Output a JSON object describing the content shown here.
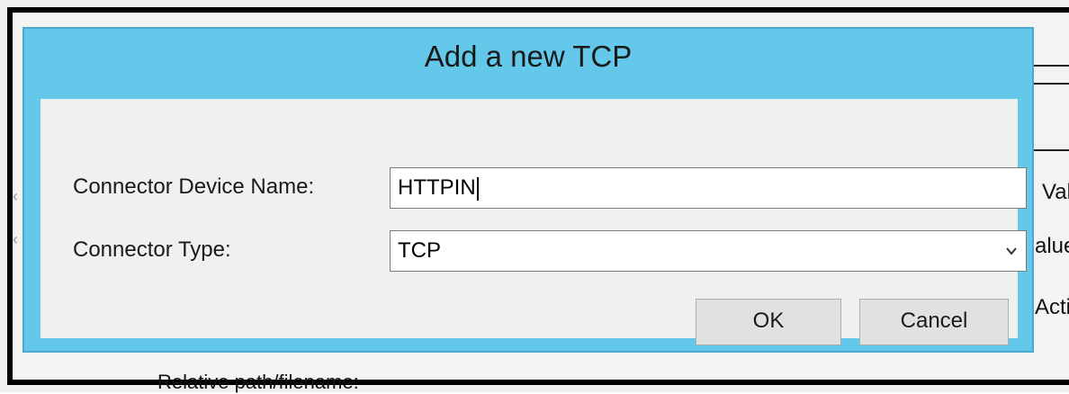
{
  "dialog": {
    "title": "Add a new TCP",
    "device_name_label": "Connector Device Name:",
    "device_name_value": "HTTPIN",
    "connector_type_label": "Connector Type:",
    "connector_type_value": "TCP",
    "ok_label": "OK",
    "cancel_label": "Cancel"
  },
  "background_window": {
    "right_labels": [
      "Val",
      "alue",
      "Acti"
    ],
    "bottom_label": "Relative path/filename:"
  }
}
